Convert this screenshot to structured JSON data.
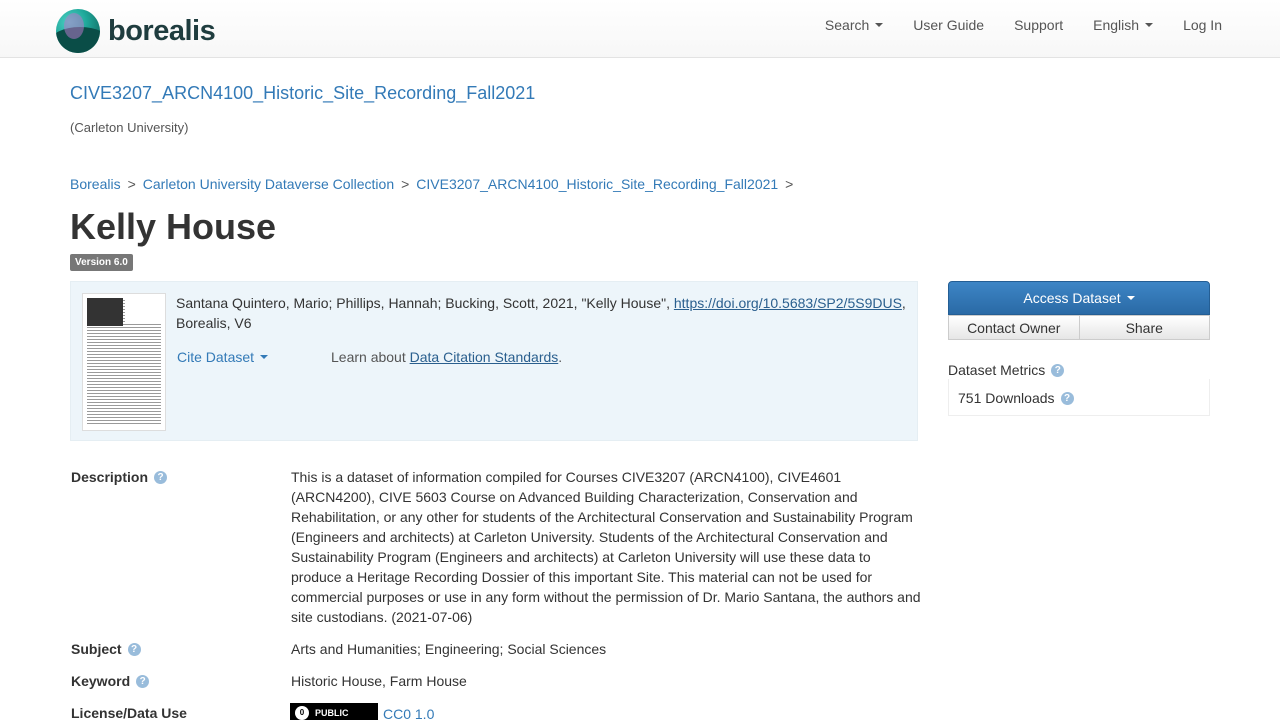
{
  "navbar": {
    "brand": "borealis",
    "items": [
      {
        "label": "Search",
        "dropdown": true
      },
      {
        "label": "User Guide",
        "dropdown": false
      },
      {
        "label": "Support",
        "dropdown": false
      },
      {
        "label": "English",
        "dropdown": true
      },
      {
        "label": "Log In",
        "dropdown": false
      }
    ]
  },
  "collection": {
    "title": "CIVE3207_ARCN4100_Historic_Site_Recording_Fall2021",
    "affiliation": "(Carleton University)"
  },
  "breadcrumb": [
    "Borealis",
    "Carleton University Dataverse Collection",
    "CIVE3207_ARCN4100_Historic_Site_Recording_Fall2021"
  ],
  "breadcrumb_separator": ">",
  "dataset": {
    "title": "Kelly House",
    "version": "Version 6.0"
  },
  "citation": {
    "text_before": "Santana Quintero, Mario; Phillips, Hannah; Bucking, Scott, 2021, \"Kelly House\", ",
    "doi_link": "https://doi.org/10.5683/SP2/5S9DUS",
    "text_after": ", Borealis, V6",
    "cite_button": "Cite Dataset",
    "learn_prefix": "Learn about ",
    "learn_link": "Data Citation Standards",
    "learn_suffix": "."
  },
  "actions": {
    "access": "Access Dataset",
    "contact": "Contact Owner",
    "share": "Share"
  },
  "metrics": {
    "label": "Dataset Metrics",
    "downloads": "751 Downloads"
  },
  "metadata": {
    "description_label": "Description",
    "description": "This is a dataset of information compiled for Courses CIVE3207 (ARCN4100), CIVE4601 (ARCN4200), CIVE 5603 Course on Advanced Building Characterization, Conservation and Rehabilitation, or any other for students of the Architectural Conservation and Sustainability Program (Engineers and architects) at Carleton University. Students of the Architectural Conservation and Sustainability Program (Engineers and architects) at Carleton University will use these data to produce a Heritage Recording Dossier of this important Site. This material can not be used for commercial purposes or use in any form without the permission of Dr. Mario Santana, the authors and site custodians. (2021-07-06)",
    "subject_label": "Subject",
    "subject": "Arts and Humanities; Engineering; Social Sciences",
    "keyword_label": "Keyword",
    "keyword": "Historic House, Farm House",
    "license_label": "License/Data Use",
    "license_badge": "PUBLIC",
    "license_link": "CC0 1.0"
  },
  "colors": {
    "link": "#337ab7",
    "primary_button": "#2a6aa6",
    "citation_bg": "#edf5fa",
    "version_badge": "#777777"
  }
}
